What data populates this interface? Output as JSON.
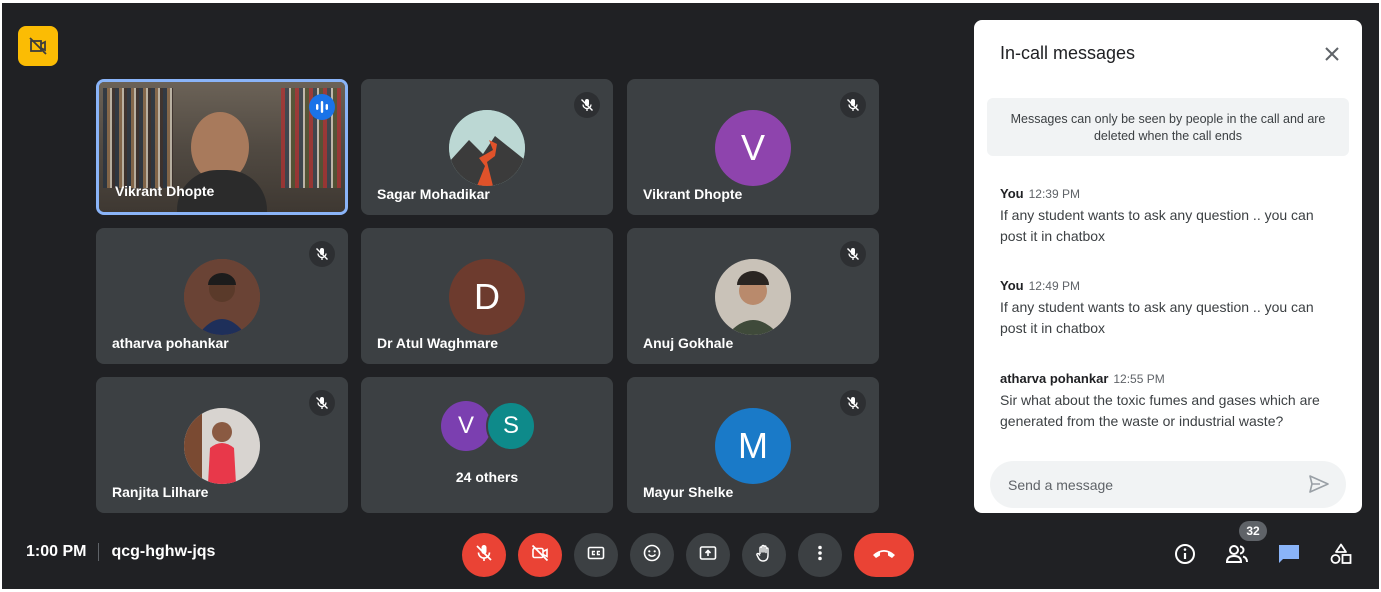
{
  "tiles": [
    {
      "name": "Vikrant Dhopte"
    },
    {
      "name": "Sagar Mohadikar"
    },
    {
      "name": "Vikrant Dhopte",
      "initial": "V",
      "color": "#8e44ad"
    },
    {
      "name": "atharva pohankar"
    },
    {
      "name": "Dr Atul Waghmare",
      "initial": "D",
      "color": "#6d3b2e"
    },
    {
      "name": "Anuj Gokhale"
    },
    {
      "name": "Ranjita Lilhare"
    },
    {
      "name": "24 others",
      "initials": [
        "V",
        "S"
      ],
      "colors": [
        "#7b3fb0",
        "#0e8a8a"
      ]
    },
    {
      "name": "Mayur Shelke",
      "initial": "M",
      "color": "#1a7ac8"
    }
  ],
  "chat": {
    "title": "In-call messages",
    "notice": "Messages can only be seen by people in the call and are deleted when the call ends",
    "messages": [
      {
        "sender": "You",
        "time": "12:39 PM",
        "text": "If any student wants to ask any question .. you can post it in chatbox"
      },
      {
        "sender": "You",
        "time": "12:49 PM",
        "text": "If any student wants to ask any question .. you can post it in chatbox"
      },
      {
        "sender": "atharva pohankar",
        "time": "12:55 PM",
        "text": "Sir what about the toxic fumes and gases which are generated from the waste or industrial waste?"
      }
    ],
    "input_placeholder": "Send a message"
  },
  "bottom": {
    "time": "1:00 PM",
    "meeting_code": "qcg-hghw-jqs",
    "participant_count": "32"
  },
  "colors": {
    "background": "#202124",
    "tile": "#3c4043",
    "danger": "#ea4335",
    "accent": "#8ab4f8",
    "badge": "#fbbc04"
  },
  "icons": [
    "no-video-corner-icon",
    "mic-off-icon",
    "camera-off-icon",
    "captions-icon",
    "emoji-icon",
    "present-icon",
    "raise-hand-icon",
    "more-options-icon",
    "end-call-icon",
    "info-icon",
    "people-icon",
    "chat-icon",
    "activities-icon",
    "close-icon",
    "send-icon",
    "audio-wave-icon"
  ]
}
